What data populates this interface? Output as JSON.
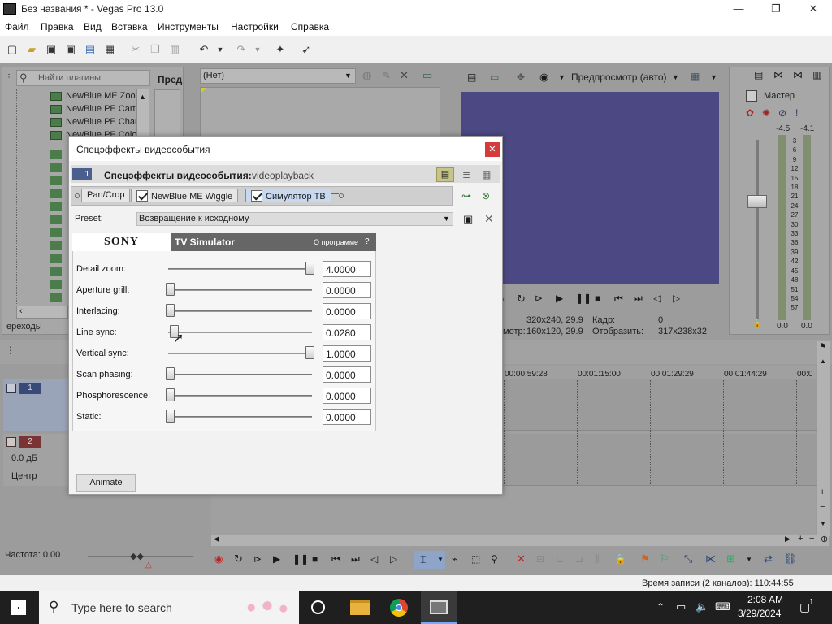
{
  "window": {
    "title": "Без названия * - Vegas Pro 13.0"
  },
  "menu": [
    "Файл",
    "Правка",
    "Вид",
    "Вставка",
    "Инструменты",
    "Настройки",
    "Справка"
  ],
  "plugins": {
    "search_placeholder": "Найти плагины",
    "tab_label": "Пред",
    "items": [
      "NewBlue ME Zoom",
      "NewBlue PE Carto",
      "NewBlue PE Charc",
      "NewBlue PE Color"
    ],
    "bottom_tab": "ереходы"
  },
  "preview": {
    "combo_none": "(Нет)",
    "mode_label": "Предпросмотр (авто)",
    "project_res": "320x240, 29.9",
    "preview_res_label": "мотр:",
    "preview_res": "160x120, 29.9",
    "frame_label": "Кадр:",
    "frame_value": "0",
    "display_label": "Отобразить:",
    "display_value": "317x238x32"
  },
  "mixer": {
    "title": "Мастер",
    "left_db": "-4.5",
    "right_db": "-4.1",
    "scale": [
      "3",
      "6",
      "9",
      "12",
      "15",
      "18",
      "21",
      "24",
      "27",
      "30",
      "33",
      "36",
      "39",
      "42",
      "45",
      "48",
      "51",
      "54",
      "57"
    ],
    "bottom_left": "0.0",
    "bottom_right": "0.0"
  },
  "tracks": {
    "track1_num": "1",
    "track2_num": "2",
    "volume": "0.0 дБ",
    "pan": "Центр"
  },
  "timeline": {
    "ruler": [
      "00:00:59:28",
      "00:01:15:00",
      "00:01:29:29",
      "00:01:44:29",
      "00:0"
    ],
    "rate_label": "Частота: 0.00"
  },
  "status": {
    "record_time": "Время записи (2 каналов): 110:44:55"
  },
  "dialog": {
    "title": "Спецэффекты видеособытия",
    "header_label": "Спецэффекты видеособытия:",
    "header_value": "videoplayback",
    "track_num": "1",
    "chain": [
      "Pan/Crop",
      "NewBlue ME Wiggle",
      "Симулятор ТВ"
    ],
    "preset_label": "Preset:",
    "preset_value": "Возвращение к исходному",
    "vendor_logo": "SONY",
    "plugin_name": "TV Simulator",
    "about_label": "О программе",
    "help_label": "?",
    "animate_label": "Animate",
    "params": [
      {
        "label": "Detail zoom:",
        "value": "4.0000",
        "level": 1.0
      },
      {
        "label": "Aperture grill:",
        "value": "0.0000",
        "level": 0.0
      },
      {
        "label": "Interlacing:",
        "value": "0.0000",
        "level": 0.0
      },
      {
        "label": "Line sync:",
        "value": "0.0280",
        "level": 0.028
      },
      {
        "label": "Vertical sync:",
        "value": "1.0000",
        "level": 1.0
      },
      {
        "label": "Scan phasing:",
        "value": "0.0000",
        "level": 0.0
      },
      {
        "label": "Phosphorescence:",
        "value": "0.0000",
        "level": 0.0
      },
      {
        "label": "Static:",
        "value": "0.0000",
        "level": 0.0
      }
    ]
  },
  "taskbar": {
    "search_placeholder": "Type here to search",
    "time": "2:08 AM",
    "date": "3/29/2024",
    "notif_count": "1"
  }
}
